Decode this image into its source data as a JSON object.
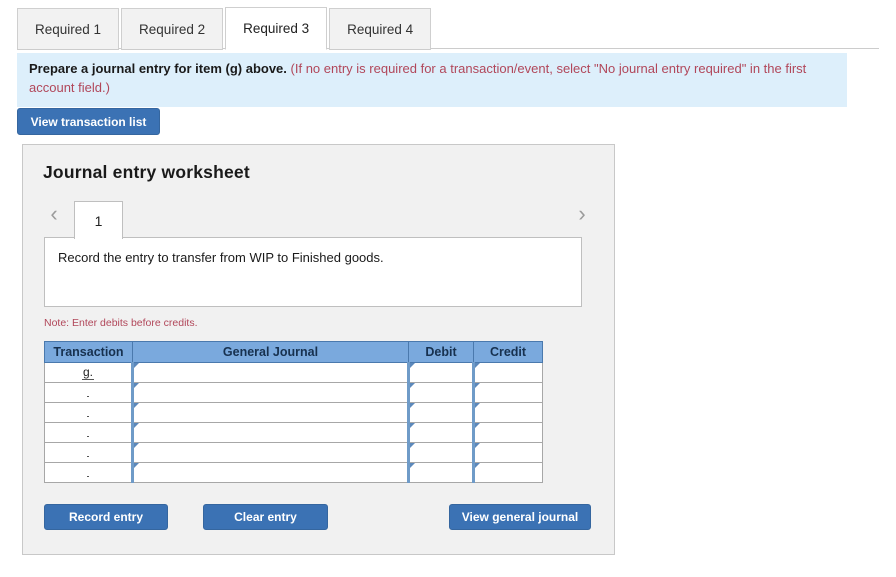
{
  "tabs": [
    {
      "label": "Required 1",
      "active": false
    },
    {
      "label": "Required 2",
      "active": false
    },
    {
      "label": "Required 3",
      "active": true
    },
    {
      "label": "Required 4",
      "active": false
    }
  ],
  "instructions": {
    "main": "Prepare a journal entry for item (g) above.",
    "note": "(If no entry is required for a transaction/event, select \"No journal entry required\" in the first account field.)"
  },
  "toolbar": {
    "view_transaction_list": "View transaction list"
  },
  "worksheet": {
    "title": "Journal entry worksheet",
    "pager": {
      "prev_icon": "chevron-left-icon",
      "next_icon": "chevron-right-icon",
      "current_page": "1"
    },
    "prompt": "Record the entry to transfer from WIP to Finished goods.",
    "note": "Note: Enter debits before credits.",
    "table": {
      "headers": [
        "Transaction",
        "General Journal",
        "Debit",
        "Credit"
      ],
      "rows": [
        {
          "transaction": "g.",
          "general_journal": "",
          "debit": "",
          "credit": ""
        },
        {
          "transaction": "",
          "general_journal": "",
          "debit": "",
          "credit": ""
        },
        {
          "transaction": "",
          "general_journal": "",
          "debit": "",
          "credit": ""
        },
        {
          "transaction": "",
          "general_journal": "",
          "debit": "",
          "credit": ""
        },
        {
          "transaction": "",
          "general_journal": "",
          "debit": "",
          "credit": ""
        },
        {
          "transaction": "",
          "general_journal": "",
          "debit": "",
          "credit": ""
        }
      ]
    },
    "buttons": {
      "record_entry": "Record entry",
      "clear_entry": "Clear entry",
      "view_general_journal": "View general journal"
    }
  },
  "colors": {
    "accent_blue": "#3b72b4",
    "table_header_blue": "#7aa9dd",
    "banner_blue": "#ddeffb",
    "note_red": "#b1475a",
    "panel_gray": "#f1f1f1"
  }
}
